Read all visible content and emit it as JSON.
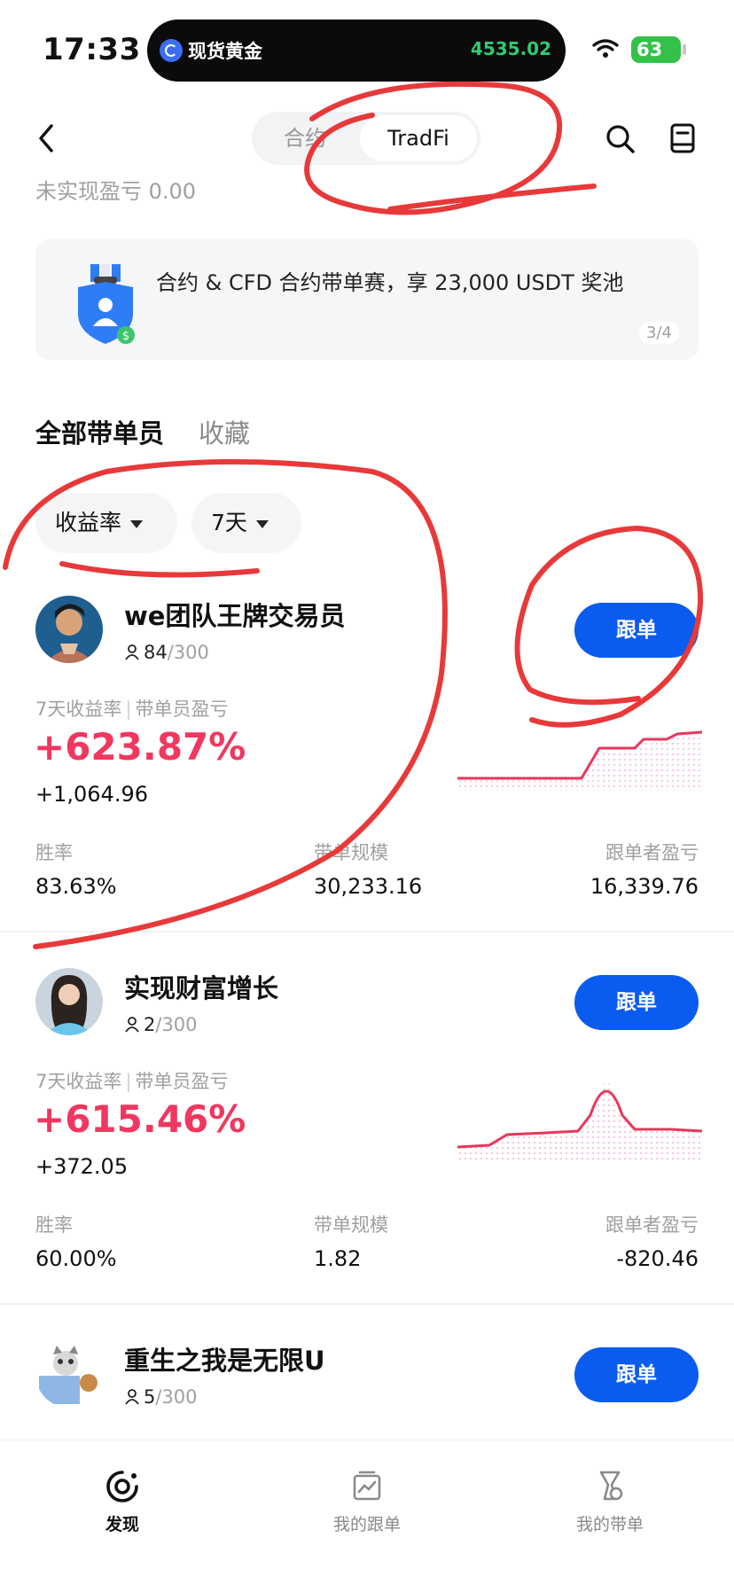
{
  "status_bar": {
    "time": "17:33",
    "island_title": "现货黄金",
    "island_price": "4535.02",
    "battery": "63"
  },
  "header": {
    "segments": [
      "合约",
      "TradFi"
    ],
    "active_segment": "TradFi",
    "unrealized_pnl": "未实现盈亏 0.00"
  },
  "banner": {
    "text": "合约 & CFD 合约带单赛，享 23,000 USDT 奖池",
    "page": "3/4"
  },
  "tabs": [
    "全部带单员",
    "收藏"
  ],
  "filters": [
    "收益率",
    "7天"
  ],
  "labels": {
    "follow": "跟单",
    "metric_roi": "7天收益率",
    "metric_pnl": "带单员盈亏",
    "win_rate": "胜率",
    "aum": "带单规模",
    "follower_pnl": "跟单者盈亏"
  },
  "traders": [
    {
      "name": "we团队王牌交易员",
      "followers": "84",
      "capacity": "/300",
      "roi": "+623.87%",
      "pnl": "+1,064.96",
      "win_rate": "83.63%",
      "aum": "30,233.16",
      "follower_pnl": "16,339.76"
    },
    {
      "name": "实现财富增长",
      "followers": "2",
      "capacity": "/300",
      "roi": "+615.46%",
      "pnl": "+372.05",
      "win_rate": "60.00%",
      "aum": "1.82",
      "follower_pnl": "-820.46"
    },
    {
      "name": "重生之我是无限U",
      "followers": "5",
      "capacity": "/300"
    }
  ],
  "bottom_nav": [
    "发现",
    "我的跟单",
    "我的带单"
  ],
  "colors": {
    "accent_blue": "#0a5bf0",
    "profit_red": "#f0375f",
    "island_green": "#2ecc71",
    "annotation_red": "#e8393a"
  },
  "icons": [
    "back-icon",
    "search-icon",
    "book-icon",
    "person-icon",
    "discover-icon",
    "my-copy-icon",
    "my-lead-icon",
    "wifi-icon"
  ]
}
